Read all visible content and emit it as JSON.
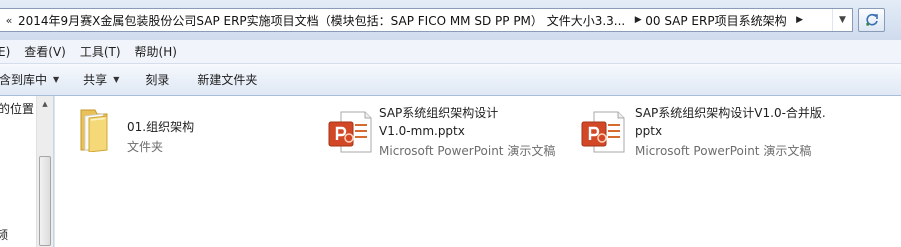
{
  "address": {
    "back_chevron": "«",
    "path_segment_1": "2014年9月赛X金属包装股份公司SAP ERP实施项目文档（模块包括：SAP FICO MM SD PP PM）  文件大小3.3...",
    "path_segment_2": "00 SAP ERP项目系统架构",
    "separator": "▶",
    "dropdown": "▼",
    "refresh_icon": "refresh-icon"
  },
  "menu": {
    "items": [
      "E)",
      "查看(V)",
      "工具(T)",
      "帮助(H)"
    ]
  },
  "toolbar": {
    "include_in_library": "含到库中",
    "share": "共享",
    "burn": "刻录",
    "new_folder": "新建文件夹",
    "caret": "▼"
  },
  "nav": {
    "location_label": "的位置",
    "bottom_label": "频",
    "scroll_up": "▲"
  },
  "files": [
    {
      "name_line1": "01.组织架构",
      "name_line2": "",
      "type": "文件夹",
      "icon": "folder-icon"
    },
    {
      "name_line1": "SAP系统组织架构设计",
      "name_line2": "V1.0-mm.pptx",
      "type": "Microsoft PowerPoint 演示文稿",
      "icon": "powerpoint-file-icon"
    },
    {
      "name_line1": "SAP系统组织架构设计V1.0-合并版.",
      "name_line2": "pptx",
      "type": "Microsoft PowerPoint 演示文稿",
      "icon": "powerpoint-file-icon"
    }
  ]
}
